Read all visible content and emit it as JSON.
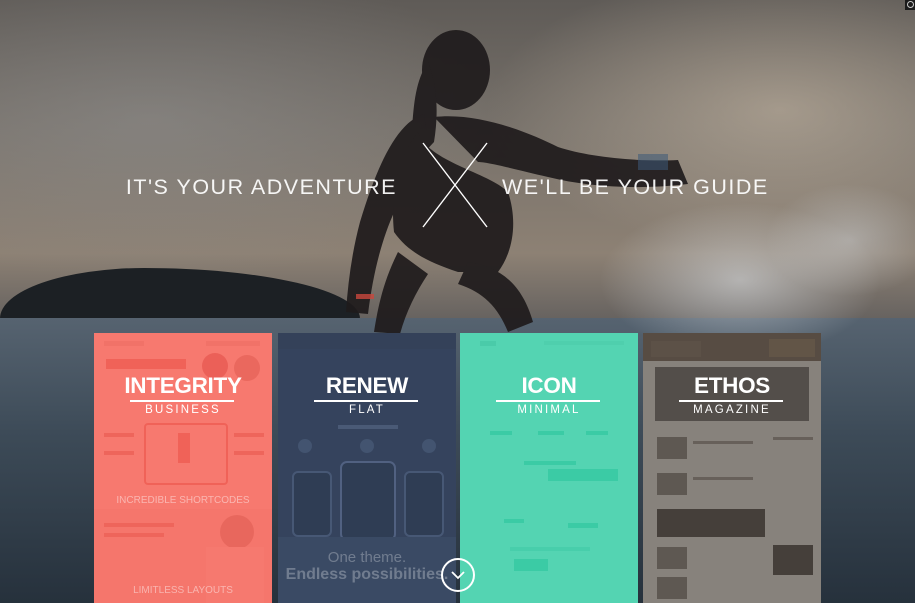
{
  "hero": {
    "tagline_left": "IT'S YOUR ADVENTURE",
    "tagline_right": "WE'LL BE YOUR GUIDE"
  },
  "cards": [
    {
      "title": "INTEGRITY",
      "subtitle": "BUSINESS",
      "tint": "#f7675c",
      "preview_text": [
        "INCREDIBLE SHORTCODES",
        "LIMITLESS LAYOUTS"
      ]
    },
    {
      "title": "RENEW",
      "subtitle": "FLAT",
      "tint": "#3d4d68",
      "preview_text": [
        "One theme.",
        "Endless possibilities."
      ]
    },
    {
      "title": "ICON",
      "subtitle": "MINIMAL",
      "tint": "#3ccea8"
    },
    {
      "title": "ETHOS",
      "subtitle": "MAGAZINE",
      "tint": "#4a4540"
    }
  ],
  "icons": {
    "logo": "x-icon",
    "scroll": "chevron-down-icon",
    "corner": "settings-icon"
  }
}
